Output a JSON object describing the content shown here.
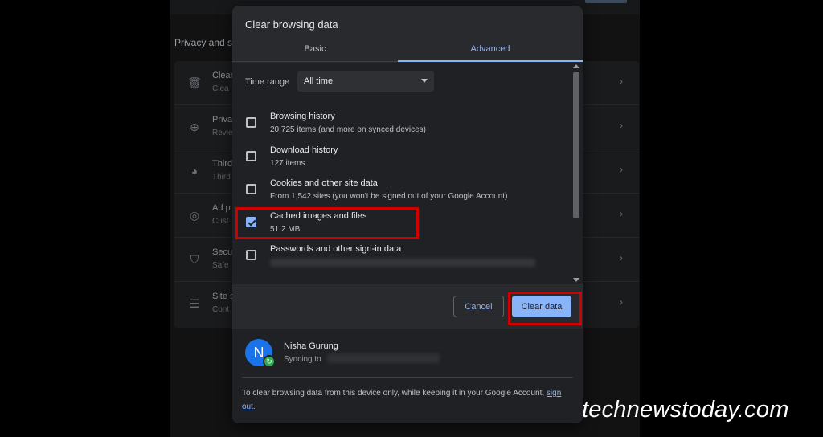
{
  "background": {
    "section_title": "Privacy and s",
    "rows": [
      {
        "title": "Clear",
        "subtitle": "Clea",
        "icon": "trash-icon"
      },
      {
        "title": "Priva",
        "subtitle": "Revie",
        "icon": "add-circle-icon"
      },
      {
        "title": "Third",
        "subtitle": "Third",
        "icon": "cookie-icon"
      },
      {
        "title": "Ad p",
        "subtitle": "Cust",
        "icon": "ad-privacy-icon"
      },
      {
        "title": "Secu",
        "subtitle": "Safe",
        "icon": "shield-icon"
      },
      {
        "title": "Site s",
        "subtitle": "Cont",
        "icon": "sliders-icon"
      }
    ]
  },
  "dialog": {
    "title": "Clear browsing data",
    "tabs": [
      {
        "label": "Basic",
        "active": false
      },
      {
        "label": "Advanced",
        "active": true
      }
    ],
    "time_range": {
      "label": "Time range",
      "value": "All time"
    },
    "items": [
      {
        "name": "Browsing history",
        "desc": "20,725 items (and more on synced devices)",
        "checked": false
      },
      {
        "name": "Download history",
        "desc": "127 items",
        "checked": false
      },
      {
        "name": "Cookies and other site data",
        "desc": "From 1,542 sites (you won't be signed out of your Google Account)",
        "checked": false
      },
      {
        "name": "Cached images and files",
        "desc": "51.2 MB",
        "checked": true
      },
      {
        "name": "Passwords and other sign-in data",
        "desc": "",
        "checked": false
      }
    ],
    "buttons": {
      "cancel": "Cancel",
      "clear": "Clear data"
    },
    "account": {
      "initial": "N",
      "name": "Nisha Gurung",
      "sync_label": "Syncing to"
    },
    "footnote_text": "To clear browsing data from this device only, while keeping it in your Google Account, ",
    "footnote_link": "sign out",
    "footnote_end": "."
  },
  "watermark": "technewstoday.com",
  "colors": {
    "accent": "#8ab4f8",
    "highlight": "#d00000",
    "dialog_bg": "#292a2d"
  }
}
